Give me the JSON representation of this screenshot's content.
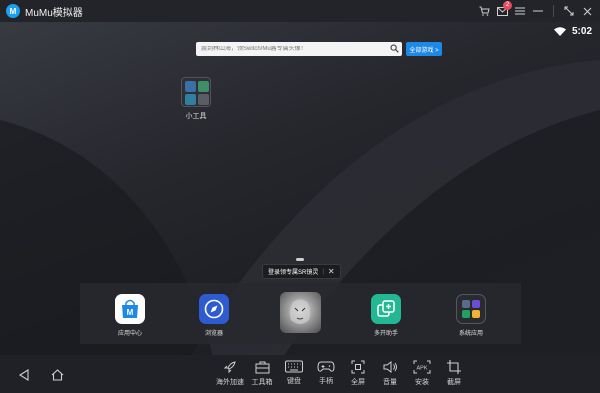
{
  "titlebar": {
    "app_name": "MuMu模拟器",
    "logo_letter": "M",
    "icons": [
      "cart-icon",
      "mail-icon",
      "menu-icon",
      "minimize-icon",
      "resize-icon",
      "close-icon"
    ],
    "mail_badge": "2"
  },
  "status": {
    "time": "5:02",
    "wifi_icon": "wifi-icon"
  },
  "search": {
    "placeholder": "震到林山海，领Switch/Mu酱专属头像！",
    "button_label": "全部游戏 >"
  },
  "desktop": {
    "tool_label": "小工具"
  },
  "dock": {
    "tooltip": "登录领专属SR镜灵",
    "items": [
      {
        "label": "应用中心",
        "icon": "app-store-icon"
      },
      {
        "label": "浏览器",
        "icon": "browser-compass-icon"
      },
      {
        "label": "",
        "icon": "game-character-icon"
      },
      {
        "label": "多开助手",
        "icon": "multi-instance-icon"
      },
      {
        "label": "系统应用",
        "icon": "system-apps-icon"
      }
    ]
  },
  "bottombar": {
    "tools": [
      {
        "label": "海外加速",
        "icon": "rocket-icon"
      },
      {
        "label": "工具箱",
        "icon": "toolbox-icon"
      },
      {
        "label": "键盘",
        "icon": "keyboard-icon"
      },
      {
        "label": "手柄",
        "icon": "gamepad-icon"
      },
      {
        "label": "全屏",
        "icon": "fullscreen-icon"
      },
      {
        "label": "音量",
        "icon": "volume-icon"
      },
      {
        "label": "安装",
        "icon": "apk-install-icon"
      },
      {
        "label": "截屏",
        "icon": "screenshot-icon"
      }
    ]
  },
  "colors": {
    "accent": "#1e88e5",
    "badge": "#e84a5f",
    "logo": "#1ea0f0",
    "multi": "#23b893"
  }
}
